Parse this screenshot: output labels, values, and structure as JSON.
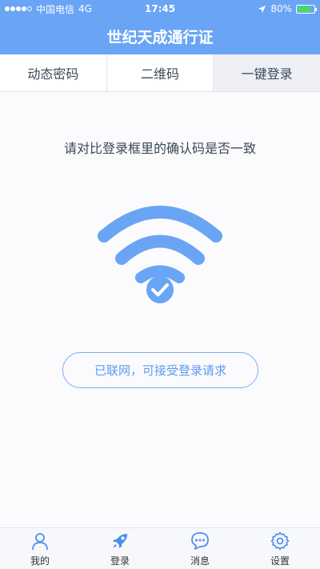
{
  "status_bar": {
    "carrier": "中国电信",
    "network": "4G",
    "time": "17:45",
    "battery_percent": "80%",
    "battery_level": 0.8,
    "signal_bars": 4
  },
  "header": {
    "title": "世纪天成通行证"
  },
  "tabs": [
    {
      "label": "动态密码",
      "active": false
    },
    {
      "label": "二维码",
      "active": false
    },
    {
      "label": "一键登录",
      "active": true
    }
  ],
  "main": {
    "instruction": "请对比登录框里的确认码是否一致",
    "status_text": "已联网，可接受登录请求"
  },
  "tab_bar": {
    "items": [
      {
        "label": "我的",
        "icon": "user-icon"
      },
      {
        "label": "登录",
        "icon": "rocket-icon"
      },
      {
        "label": "消息",
        "icon": "chat-bubble-icon"
      },
      {
        "label": "设置",
        "icon": "gear-icon"
      }
    ]
  },
  "colors": {
    "brand": "#6aa4f5",
    "accent": "#5c9af0",
    "active_tab_bg": "#eef0f6",
    "battery_fill": "#4cd964"
  }
}
